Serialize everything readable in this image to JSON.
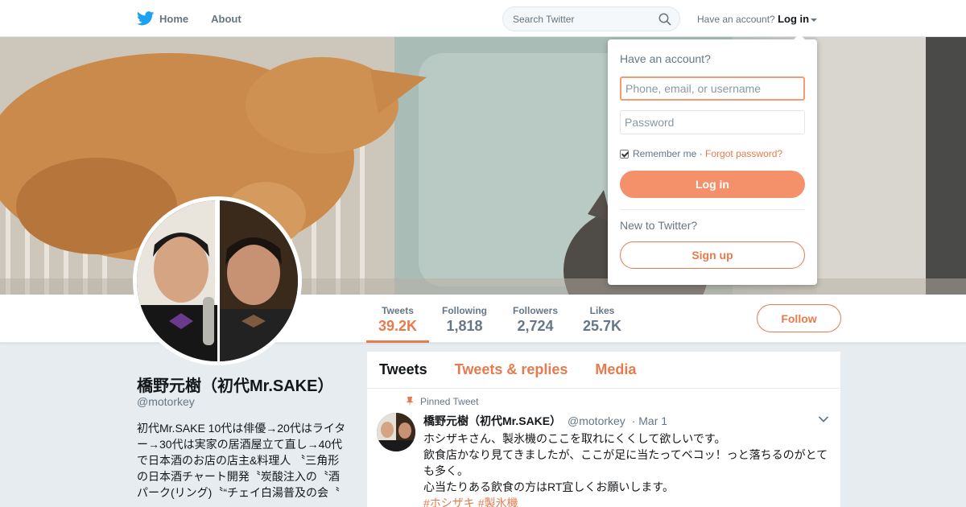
{
  "nav": {
    "home_label": "Home",
    "about_label": "About",
    "search_placeholder": "Search Twitter",
    "account_prompt": "Have an account?",
    "login_label": "Log in"
  },
  "profile": {
    "name": "橋野元樹（初代Mr.SAKE）",
    "handle": "@motorkey",
    "bio": "初代Mr.SAKE 10代は俳優→20代はライター→30代は実家の居酒屋立て直し→40代で日本酒のお店の店主&料理人 〝三角形の日本酒チャート開発〝炭酸注入の〝酒パーク(リング)〝“チェイ白湯普及の会〝"
  },
  "stats": [
    {
      "label": "Tweets",
      "value": "39.2K",
      "active": true
    },
    {
      "label": "Following",
      "value": "1,818",
      "active": false
    },
    {
      "label": "Followers",
      "value": "2,724",
      "active": false
    },
    {
      "label": "Likes",
      "value": "25.7K",
      "active": false
    }
  ],
  "follow_label": "Follow",
  "timeline": {
    "tabs": [
      "Tweets",
      "Tweets & replies",
      "Media"
    ],
    "active_tab": "Tweets"
  },
  "tweet": {
    "pinned_label": "Pinned Tweet",
    "author": "橋野元樹（初代Mr.SAKE）",
    "handle": "@motorkey",
    "date": "· Mar 1",
    "lines": [
      "ホシザキさん、製氷機のここを取れにくくして欲しいです。",
      "飲食店かなり見てきましたが、ここが足に当たってベコッ！っと落ちるのがとても多く。",
      "心当たりある飲食の方はRT宜しくお願いします。"
    ],
    "hashtags": [
      "#ホシザキ",
      "#製氷機"
    ]
  },
  "login_dropdown": {
    "title": "Have an account?",
    "username_placeholder": "Phone, email, or username",
    "password_placeholder": "Password",
    "remember_label": "Remember me",
    "separator": "·",
    "forgot_label": "Forgot password?",
    "login_button": "Log in",
    "new_label": "New to Twitter?",
    "signup_button": "Sign up"
  },
  "colors": {
    "accent": "#e87a4e",
    "accent_light": "#f5916a",
    "brand_bird": "#1da1f2",
    "text_secondary": "#657786"
  },
  "icons": [
    "twitter-bird-icon",
    "home-icon",
    "search-icon",
    "caret-down-icon",
    "pin-icon",
    "chevron-down-icon"
  ]
}
